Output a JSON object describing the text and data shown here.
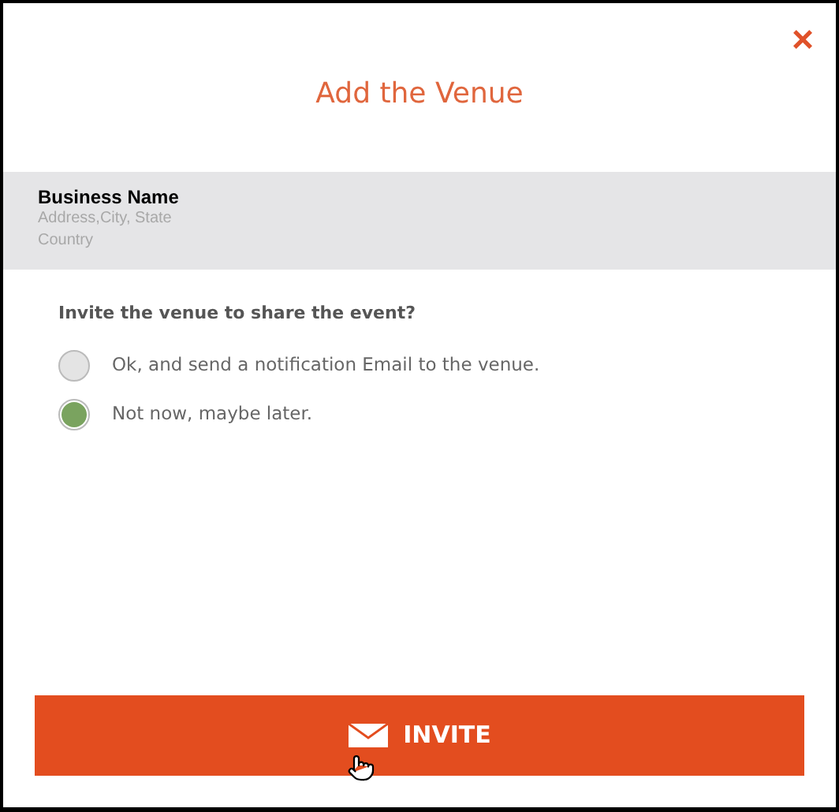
{
  "dialog": {
    "title": "Add the Venue",
    "close": "×"
  },
  "venue": {
    "name": "Business Name",
    "address": "Address,City, State",
    "country": "Country"
  },
  "question": "Invite the venue to share the event?",
  "options": [
    {
      "label": "Ok, and send a notification Email to the venue.",
      "selected": false
    },
    {
      "label": "Not now, maybe later.",
      "selected": true
    }
  ],
  "invite_button": {
    "label": "INVITE"
  }
}
